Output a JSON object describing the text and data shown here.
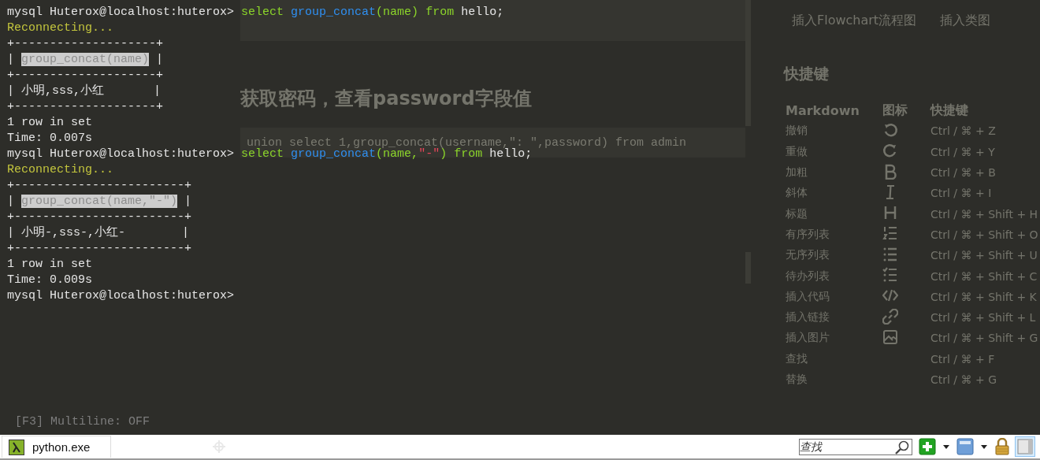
{
  "background_page": {
    "links": [
      "插入Flowchart流程图",
      "插入类图"
    ],
    "code_sample": "union select 1,group_concat(username,\": \",password) from admin",
    "heading": "获取密码，查看password字段值",
    "shortcuts": {
      "title": "快捷键",
      "columns": [
        "Markdown",
        "图标",
        "快捷键"
      ],
      "rows": [
        {
          "label": "撤销",
          "kind": "undo",
          "shortcut": "Ctrl / ⌘ + Z"
        },
        {
          "label": "重做",
          "kind": "redo",
          "shortcut": "Ctrl / ⌘ + Y"
        },
        {
          "label": "加粗",
          "kind": "bold",
          "shortcut": "Ctrl / ⌘ + B"
        },
        {
          "label": "斜体",
          "kind": "italic",
          "shortcut": "Ctrl / ⌘ + I"
        },
        {
          "label": "标题",
          "kind": "heading",
          "shortcut": "Ctrl / ⌘ + Shift + H"
        },
        {
          "label": "有序列表",
          "kind": "ordered",
          "shortcut": "Ctrl / ⌘ + Shift + O"
        },
        {
          "label": "无序列表",
          "kind": "unordered",
          "shortcut": "Ctrl / ⌘ + Shift + U"
        },
        {
          "label": "待办列表",
          "kind": "todo",
          "shortcut": "Ctrl / ⌘ + Shift + C"
        },
        {
          "label": "插入代码",
          "kind": "code",
          "shortcut": "Ctrl / ⌘ + Shift + K"
        },
        {
          "label": "插入链接",
          "kind": "link",
          "shortcut": "Ctrl / ⌘ + Shift + L"
        },
        {
          "label": "插入图片",
          "kind": "image",
          "shortcut": "Ctrl / ⌘ + Shift + G"
        },
        {
          "label": "查找",
          "kind": "plain",
          "shortcut": "Ctrl / ⌘ + F"
        },
        {
          "label": "替换",
          "kind": "plain",
          "shortcut": "Ctrl / ⌘ + G"
        }
      ]
    }
  },
  "terminal": {
    "lines": [
      {
        "segments": [
          {
            "text": "mysql Huterox@localhost:huterox> ",
            "color": "#e6e6e6"
          },
          {
            "text": "select ",
            "color": "#8bd42a"
          },
          {
            "text": "group_concat",
            "color": "#2f8ff0"
          },
          {
            "text": "(name) ",
            "color": "#8bd42a"
          },
          {
            "text": "from ",
            "color": "#8bd42a"
          },
          {
            "text": "hello;",
            "color": "#e6e6e6"
          }
        ]
      },
      {
        "segments": [
          {
            "text": "Reconnecting...",
            "color": "#c3c53d"
          }
        ]
      },
      {
        "segments": [
          {
            "text": "+--------------------+",
            "color": "#e6e6e6"
          }
        ]
      },
      {
        "segments": [
          {
            "text": "| ",
            "color": "#e6e6e6"
          },
          {
            "text": "group_concat(name)",
            "color": "#8e8e8e",
            "highlighted": true
          },
          {
            "text": " |",
            "color": "#e6e6e6"
          }
        ]
      },
      {
        "segments": [
          {
            "text": "+--------------------+",
            "color": "#e6e6e6"
          }
        ]
      },
      {
        "segments": [
          {
            "text": "| 小明,sss,小红       |",
            "color": "#e6e6e6"
          }
        ]
      },
      {
        "segments": [
          {
            "text": "+--------------------+",
            "color": "#e6e6e6"
          }
        ]
      },
      {
        "segments": [
          {
            "text": "1 row in set",
            "color": "#e6e6e6"
          }
        ]
      },
      {
        "segments": [
          {
            "text": "Time: 0.007s",
            "color": "#e6e6e6"
          }
        ]
      },
      {
        "segments": [
          {
            "text": "mysql Huterox@localhost:huterox> ",
            "color": "#e6e6e6"
          },
          {
            "text": "select ",
            "color": "#8bd42a"
          },
          {
            "text": "group_concat",
            "color": "#2f8ff0"
          },
          {
            "text": "(name,",
            "color": "#8bd42a"
          },
          {
            "text": "\"-\"",
            "color": "#e8455a"
          },
          {
            "text": ") ",
            "color": "#8bd42a"
          },
          {
            "text": "from ",
            "color": "#8bd42a"
          },
          {
            "text": "hello;",
            "color": "#e6e6e6"
          }
        ]
      },
      {
        "segments": [
          {
            "text": "Reconnecting...",
            "color": "#c3c53d"
          }
        ]
      },
      {
        "segments": [
          {
            "text": "+------------------------+",
            "color": "#e6e6e6"
          }
        ]
      },
      {
        "segments": [
          {
            "text": "| ",
            "color": "#e6e6e6"
          },
          {
            "text": "group_concat(name,\"-\")",
            "color": "#8e8e8e",
            "highlighted": true
          },
          {
            "text": " |",
            "color": "#e6e6e6"
          }
        ]
      },
      {
        "segments": [
          {
            "text": "+------------------------+",
            "color": "#e6e6e6"
          }
        ]
      },
      {
        "segments": [
          {
            "text": "| 小明-,sss-,小红-        |",
            "color": "#e6e6e6"
          }
        ]
      },
      {
        "segments": [
          {
            "text": "+------------------------+",
            "color": "#e6e6e6"
          }
        ]
      },
      {
        "segments": [
          {
            "text": "1 row in set",
            "color": "#e6e6e6"
          }
        ]
      },
      {
        "segments": [
          {
            "text": "Time: 0.009s",
            "color": "#e6e6e6"
          }
        ]
      },
      {
        "segments": [
          {
            "text": "mysql Huterox@localhost:huterox>",
            "color": "#e6e6e6"
          }
        ]
      }
    ],
    "status_line": "[F3] Multiline: OFF"
  },
  "taskbar": {
    "tabs": [
      {
        "label": "python.exe",
        "selected": true
      }
    ],
    "search": {
      "placeholder": "查找"
    },
    "tools": [
      {
        "kind": "add",
        "selected": false
      },
      {
        "kind": "dropdown",
        "selected": false
      },
      {
        "kind": "window",
        "selected": false
      },
      {
        "kind": "dropdown",
        "selected": false
      },
      {
        "kind": "lock",
        "selected": false
      },
      {
        "kind": "panel",
        "selected": true
      }
    ]
  }
}
